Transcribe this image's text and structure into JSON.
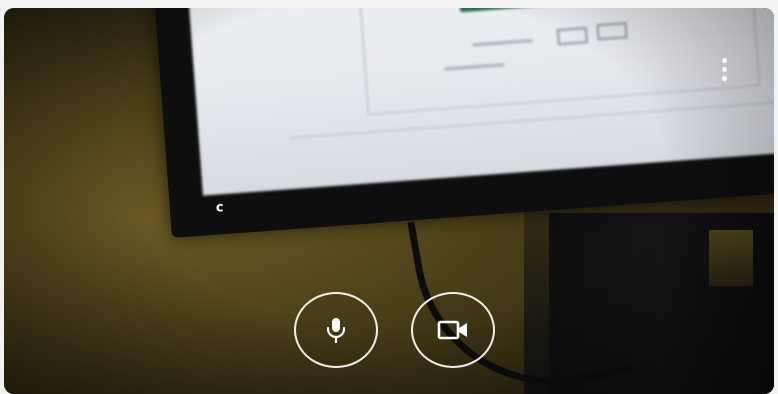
{
  "preview": {
    "monitor_logo_text": "c",
    "more_options_icon": "more-vert-icon",
    "controls": [
      {
        "name": "microphone",
        "icon": "microphone-icon",
        "state": "on"
      },
      {
        "name": "camera",
        "icon": "video-camera-icon",
        "state": "on"
      }
    ],
    "colors": {
      "control_outline": "#ffffff",
      "icon": "#ffffff",
      "background_tint": "#4e4219"
    }
  }
}
